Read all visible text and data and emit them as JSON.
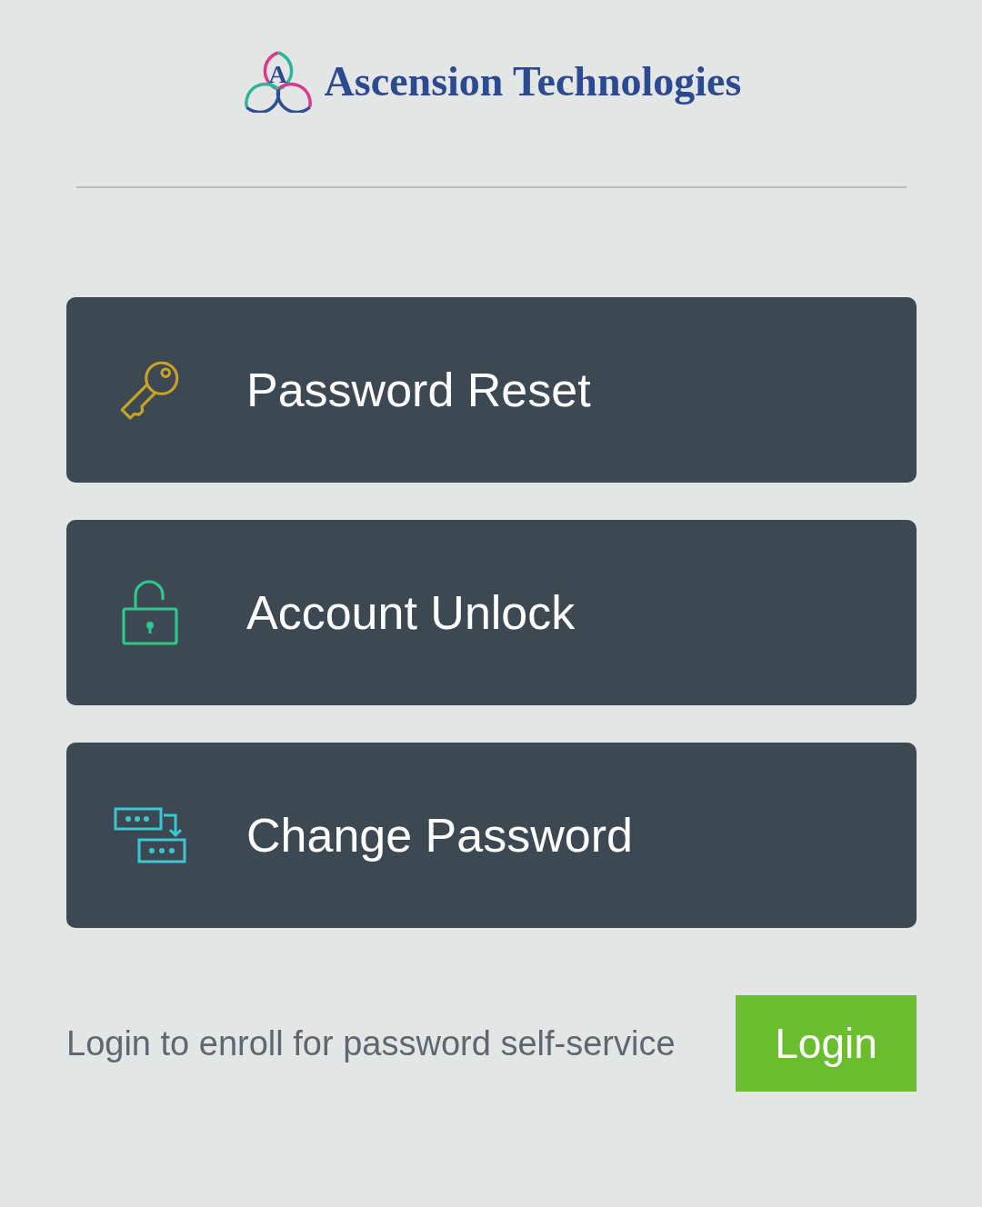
{
  "logo": {
    "letter": "A",
    "text": "Ascension Technologies"
  },
  "actions": [
    {
      "kind": "key",
      "label": "Password Reset"
    },
    {
      "kind": "unlock",
      "label": "Account Unlock"
    },
    {
      "kind": "change",
      "label": "Change Password"
    }
  ],
  "footer": {
    "text": "Login to enroll for password self-service",
    "button": "Login"
  }
}
